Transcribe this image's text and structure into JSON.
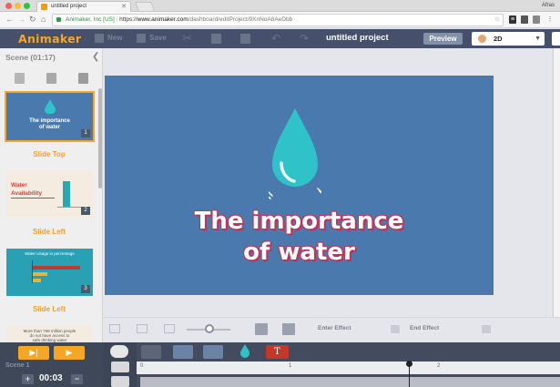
{
  "browser": {
    "tab_title": "untitled project",
    "user_name": "Afras",
    "url_secure_label": "Animaker, Inc [US]",
    "url_scheme": "https://",
    "url_domain": "www.animaker.com",
    "url_path": "/dashboard/editProject/9XnNoA8AeDbb"
  },
  "toolbar": {
    "logo": "Animaker",
    "new_label": "New",
    "save_label": "Save",
    "project_title": "untitled project",
    "preview_label": "Preview",
    "mode_value": "2D"
  },
  "scene_panel": {
    "header": "Scene  (01:17)",
    "slides": [
      {
        "number": "1",
        "transition": "Slide Top",
        "thumb_title": "The importance\nof water",
        "bg": "#4a7aad"
      },
      {
        "number": "2",
        "transition": "Slide Left",
        "thumb_title": "Water\nAvailability",
        "bg": "#f4ece0"
      },
      {
        "number": "3",
        "transition": "Slide Left",
        "thumb_title": "Water Usage in percentage",
        "bg": "#2aa0b5"
      },
      {
        "number": "",
        "transition": "",
        "thumb_title": "More than 768 million people\ndo not have access to\nsafe drinking water",
        "bg": "#f4ece0"
      }
    ]
  },
  "canvas": {
    "title": "The importance\nof water",
    "bg": "#4a7aad",
    "drop_color": "#2fc3c9",
    "title_outline": "#c0325a"
  },
  "effect_bar": {
    "enter_label": "Enter Effect",
    "end_label": "End Effect"
  },
  "timeline": {
    "scene_label": "Scene 1",
    "duration": "00:03",
    "ticks": [
      "0",
      "1",
      "2"
    ]
  },
  "colors": {
    "accent": "#f5a623",
    "toolbar_bg": "#46506a",
    "timeline_bg": "#3f4859"
  }
}
